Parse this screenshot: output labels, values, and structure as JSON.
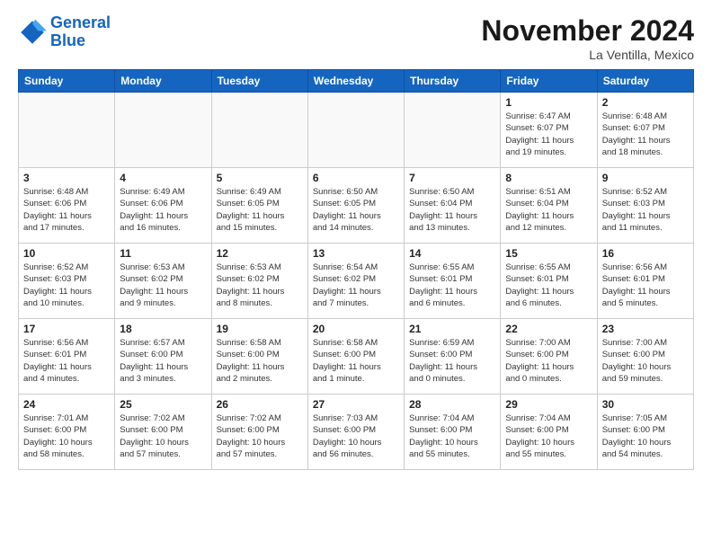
{
  "header": {
    "logo_line1": "General",
    "logo_line2": "Blue",
    "month": "November 2024",
    "location": "La Ventilla, Mexico"
  },
  "weekdays": [
    "Sunday",
    "Monday",
    "Tuesday",
    "Wednesday",
    "Thursday",
    "Friday",
    "Saturday"
  ],
  "weeks": [
    [
      {
        "day": "",
        "info": ""
      },
      {
        "day": "",
        "info": ""
      },
      {
        "day": "",
        "info": ""
      },
      {
        "day": "",
        "info": ""
      },
      {
        "day": "",
        "info": ""
      },
      {
        "day": "1",
        "info": "Sunrise: 6:47 AM\nSunset: 6:07 PM\nDaylight: 11 hours\nand 19 minutes."
      },
      {
        "day": "2",
        "info": "Sunrise: 6:48 AM\nSunset: 6:07 PM\nDaylight: 11 hours\nand 18 minutes."
      }
    ],
    [
      {
        "day": "3",
        "info": "Sunrise: 6:48 AM\nSunset: 6:06 PM\nDaylight: 11 hours\nand 17 minutes."
      },
      {
        "day": "4",
        "info": "Sunrise: 6:49 AM\nSunset: 6:06 PM\nDaylight: 11 hours\nand 16 minutes."
      },
      {
        "day": "5",
        "info": "Sunrise: 6:49 AM\nSunset: 6:05 PM\nDaylight: 11 hours\nand 15 minutes."
      },
      {
        "day": "6",
        "info": "Sunrise: 6:50 AM\nSunset: 6:05 PM\nDaylight: 11 hours\nand 14 minutes."
      },
      {
        "day": "7",
        "info": "Sunrise: 6:50 AM\nSunset: 6:04 PM\nDaylight: 11 hours\nand 13 minutes."
      },
      {
        "day": "8",
        "info": "Sunrise: 6:51 AM\nSunset: 6:04 PM\nDaylight: 11 hours\nand 12 minutes."
      },
      {
        "day": "9",
        "info": "Sunrise: 6:52 AM\nSunset: 6:03 PM\nDaylight: 11 hours\nand 11 minutes."
      }
    ],
    [
      {
        "day": "10",
        "info": "Sunrise: 6:52 AM\nSunset: 6:03 PM\nDaylight: 11 hours\nand 10 minutes."
      },
      {
        "day": "11",
        "info": "Sunrise: 6:53 AM\nSunset: 6:02 PM\nDaylight: 11 hours\nand 9 minutes."
      },
      {
        "day": "12",
        "info": "Sunrise: 6:53 AM\nSunset: 6:02 PM\nDaylight: 11 hours\nand 8 minutes."
      },
      {
        "day": "13",
        "info": "Sunrise: 6:54 AM\nSunset: 6:02 PM\nDaylight: 11 hours\nand 7 minutes."
      },
      {
        "day": "14",
        "info": "Sunrise: 6:55 AM\nSunset: 6:01 PM\nDaylight: 11 hours\nand 6 minutes."
      },
      {
        "day": "15",
        "info": "Sunrise: 6:55 AM\nSunset: 6:01 PM\nDaylight: 11 hours\nand 6 minutes."
      },
      {
        "day": "16",
        "info": "Sunrise: 6:56 AM\nSunset: 6:01 PM\nDaylight: 11 hours\nand 5 minutes."
      }
    ],
    [
      {
        "day": "17",
        "info": "Sunrise: 6:56 AM\nSunset: 6:01 PM\nDaylight: 11 hours\nand 4 minutes."
      },
      {
        "day": "18",
        "info": "Sunrise: 6:57 AM\nSunset: 6:00 PM\nDaylight: 11 hours\nand 3 minutes."
      },
      {
        "day": "19",
        "info": "Sunrise: 6:58 AM\nSunset: 6:00 PM\nDaylight: 11 hours\nand 2 minutes."
      },
      {
        "day": "20",
        "info": "Sunrise: 6:58 AM\nSunset: 6:00 PM\nDaylight: 11 hours\nand 1 minute."
      },
      {
        "day": "21",
        "info": "Sunrise: 6:59 AM\nSunset: 6:00 PM\nDaylight: 11 hours\nand 0 minutes."
      },
      {
        "day": "22",
        "info": "Sunrise: 7:00 AM\nSunset: 6:00 PM\nDaylight: 11 hours\nand 0 minutes."
      },
      {
        "day": "23",
        "info": "Sunrise: 7:00 AM\nSunset: 6:00 PM\nDaylight: 10 hours\nand 59 minutes."
      }
    ],
    [
      {
        "day": "24",
        "info": "Sunrise: 7:01 AM\nSunset: 6:00 PM\nDaylight: 10 hours\nand 58 minutes."
      },
      {
        "day": "25",
        "info": "Sunrise: 7:02 AM\nSunset: 6:00 PM\nDaylight: 10 hours\nand 57 minutes."
      },
      {
        "day": "26",
        "info": "Sunrise: 7:02 AM\nSunset: 6:00 PM\nDaylight: 10 hours\nand 57 minutes."
      },
      {
        "day": "27",
        "info": "Sunrise: 7:03 AM\nSunset: 6:00 PM\nDaylight: 10 hours\nand 56 minutes."
      },
      {
        "day": "28",
        "info": "Sunrise: 7:04 AM\nSunset: 6:00 PM\nDaylight: 10 hours\nand 55 minutes."
      },
      {
        "day": "29",
        "info": "Sunrise: 7:04 AM\nSunset: 6:00 PM\nDaylight: 10 hours\nand 55 minutes."
      },
      {
        "day": "30",
        "info": "Sunrise: 7:05 AM\nSunset: 6:00 PM\nDaylight: 10 hours\nand 54 minutes."
      }
    ]
  ]
}
